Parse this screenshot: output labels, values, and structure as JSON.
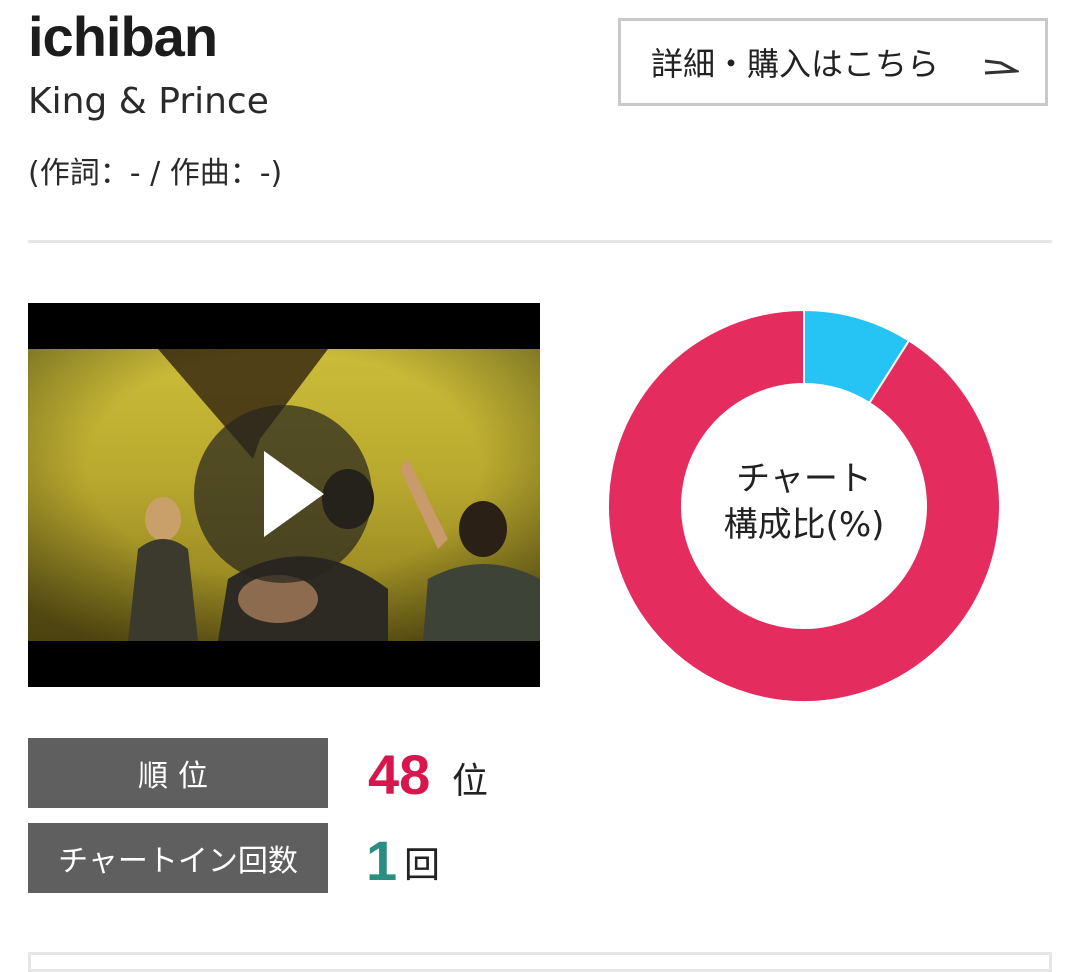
{
  "song": {
    "title": "ichiban",
    "artist": "King & Prince",
    "credits": "(作詞：- / 作曲：-)"
  },
  "buy_button": {
    "label": "詳細・購入はこちら",
    "icon": "arrow-icon"
  },
  "video": {
    "icon": "play-icon"
  },
  "chart_data": {
    "type": "pie",
    "title": "チャート\n構成比(%)",
    "categories": [
      "",
      ""
    ],
    "values": [
      9,
      91
    ],
    "colors": [
      "#26c3f5",
      "#e42d5e"
    ],
    "donut": true
  },
  "chart_center": {
    "line1": "チャート",
    "line2": "構成比(%)"
  },
  "stats": {
    "rank_label": "順位",
    "rank_value": "48",
    "rank_unit": "位",
    "chart_in_label": "チャートイン回数",
    "chart_in_value": "1",
    "chart_in_unit": "回"
  },
  "colors": {
    "rank": "#d6164c",
    "count": "#2a8f80",
    "label_bg": "#5f5f5f"
  }
}
